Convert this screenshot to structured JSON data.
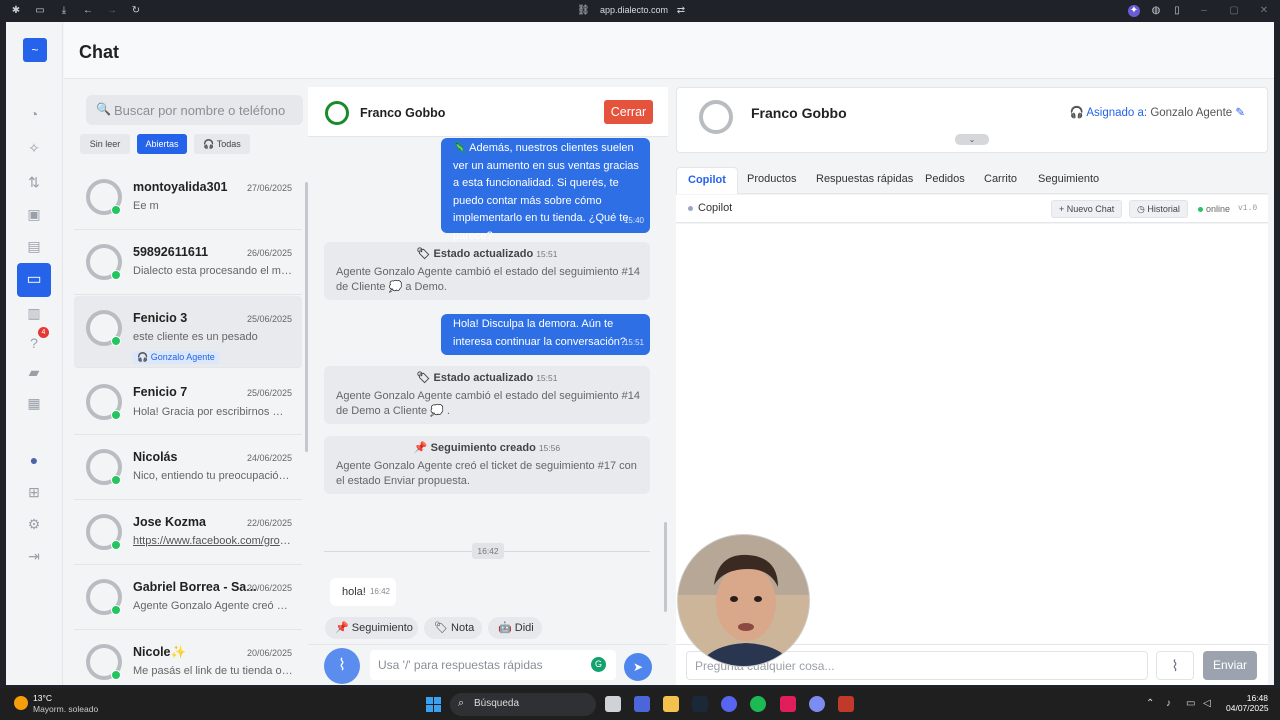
{
  "browser": {
    "url": "app.dialecto.com"
  },
  "page": {
    "title": "Chat"
  },
  "search": {
    "placeholder": "Buscar por nombre o teléfono"
  },
  "filters": {
    "unread": "Sin leer",
    "open": "Abiertas",
    "all": "Todas"
  },
  "sidebar_badge": "4",
  "conversations": [
    {
      "name": "montoyalida301",
      "date": "27/06/2025",
      "preview": "Ee m"
    },
    {
      "name": "59892611611",
      "date": "26/06/2025",
      "preview": "Dialecto esta procesando el mensaje..."
    },
    {
      "name": "Fenicio 3",
      "date": "25/06/2025",
      "preview": "este cliente es un pesado",
      "tag": "Gonzalo Agente"
    },
    {
      "name": "Fenicio 7",
      "date": "25/06/2025",
      "preview": "Hola! Gracia por escribirnos 😊 U..."
    },
    {
      "name": "Nicolás",
      "date": "24/06/2025",
      "preview": "Nico, entiendo tu preocupación. ..."
    },
    {
      "name": "Jose Kozma",
      "date": "22/06/2025",
      "preview": "https://www.facebook.com/groups/..."
    },
    {
      "name": "Gabriel Borrea - Sa...",
      "date": "20/06/2025",
      "preview": "Agente Gonzalo Agente creó el ti..."
    },
    {
      "name": "Nicole✨",
      "date": "20/06/2025",
      "preview": "Me pasás el link de tu tienda onli..."
    }
  ],
  "chat": {
    "contact": "Franco Gobbo",
    "close_label": "Cerrar",
    "msg1": {
      "text": "🦎 Además, nuestros clientes suelen ver un aumento en sus ventas gracias a esta funcionalidad. Si querés, te puedo contar más sobre cómo implementarlo en tu tienda. ¿Qué te parece?",
      "time": "15:40"
    },
    "sys1": {
      "title": "Estado actualizado",
      "time": "15:51",
      "body": "Agente Gonzalo Agente cambió el estado del seguimiento #14 de Cliente 💭 a Demo."
    },
    "msg2": {
      "text": "Hola! Disculpa la demora. Aún te interesa continuar la conversación?",
      "time": "15:51"
    },
    "sys2": {
      "title": "Estado actualizado",
      "time": "15:51",
      "body": "Agente Gonzalo Agente cambió el estado del seguimiento #14 de Demo a Cliente 💭 ."
    },
    "sys3": {
      "title": "Seguimiento creado",
      "time": "15:56",
      "body": "Agente Gonzalo Agente creó el ticket de seguimiento #17 con el estado Enviar propuesta."
    },
    "divider_time": "16:42",
    "msg3": {
      "text": "hola!",
      "time": "16:42"
    },
    "quick": {
      "followup": "Seguimiento",
      "note": "Nota",
      "didi": "Didi"
    },
    "input_placeholder": "Usa '/' para respuestas rápidas"
  },
  "right": {
    "contact": "Franco Gobbo",
    "assigned_label": "Asignado a:",
    "assigned_name": "Gonzalo Agente",
    "tabs": [
      "Copilot",
      "Productos",
      "Respuestas rápidas",
      "Pedidos",
      "Carrito",
      "Seguimiento"
    ],
    "copilot_title": "Copilot",
    "new_chat": "+ Nuevo Chat",
    "history": "Historial",
    "status": "online",
    "version": "v1.0",
    "input_placeholder": "Pregunta cualquier cosa...",
    "send": "Enviar"
  },
  "taskbar": {
    "temp": "13°C",
    "weather": "Mayorm. soleado",
    "search": "Búsqueda",
    "time": "16:48",
    "date": "04/07/2025"
  }
}
